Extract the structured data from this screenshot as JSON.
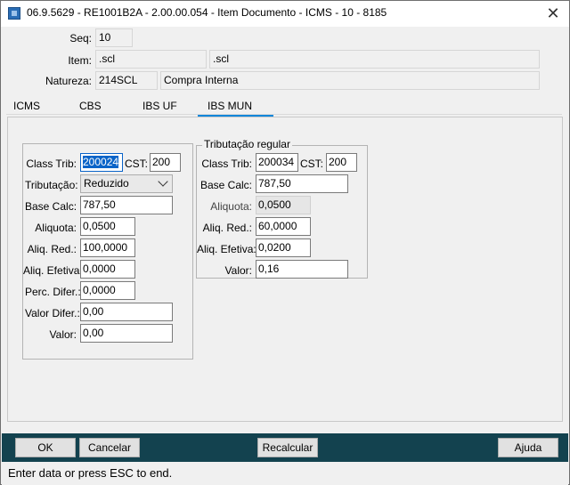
{
  "window": {
    "title": "06.9.5629 - RE1001B2A - 2.00.00.054 - Item Documento - ICMS - 10 - 8185"
  },
  "header": {
    "seq_label": "Seq:",
    "seq_value": "10",
    "item_label": "Item:",
    "item_code": ".scl",
    "item_desc": ".scl",
    "natureza_label": "Natureza:",
    "natureza_code": "214SCL",
    "natureza_desc": "Compra Interna"
  },
  "tabs": [
    {
      "label": "ICMS"
    },
    {
      "label": "CBS"
    },
    {
      "label": "IBS UF"
    },
    {
      "label": "IBS MUN",
      "active": true
    }
  ],
  "left_group": {
    "class_trib_label": "Class Trib:",
    "class_trib_value": "200024",
    "cst_label": "CST:",
    "cst_value": "200",
    "tributacao_label": "Tributação:",
    "tributacao_value": "Reduzido",
    "base_calc_label": "Base Calc:",
    "base_calc_value": "787,50",
    "aliquota_label": "Aliquota:",
    "aliquota_value": "0,0500",
    "aliq_red_label": "Aliq. Red.:",
    "aliq_red_value": "100,0000",
    "aliq_efetiva_label": "Aliq. Efetiva:",
    "aliq_efetiva_value": "0,0000",
    "perc_difer_label": "Perc. Difer.:",
    "perc_difer_value": "0,0000",
    "valor_difer_label": "Valor Difer.:",
    "valor_difer_value": "0,00",
    "valor_label": "Valor:",
    "valor_value": "0,00"
  },
  "right_group": {
    "title": "Tributação regular",
    "class_trib_label": "Class Trib:",
    "class_trib_value": "200034",
    "cst_label": "CST:",
    "cst_value": "200",
    "base_calc_label": "Base Calc:",
    "base_calc_value": "787,50",
    "aliquota_label": "Aliquota:",
    "aliquota_value": "0,0500",
    "aliq_red_label": "Aliq. Red.:",
    "aliq_red_value": "60,0000",
    "aliq_efetiva_label": "Aliq. Efetiva:",
    "aliq_efetiva_value": "0,0200",
    "valor_label": "Valor:",
    "valor_value": "0,16"
  },
  "footer": {
    "ok": "OK",
    "cancel": "Cancelar",
    "recalc": "Recalcular",
    "help": "Ajuda"
  },
  "status": {
    "text": "Enter data or press ESC to end."
  },
  "colors": {
    "footer_bg": "#13424f",
    "tab_accent": "#0f86d9",
    "selection": "#0a64c8"
  }
}
